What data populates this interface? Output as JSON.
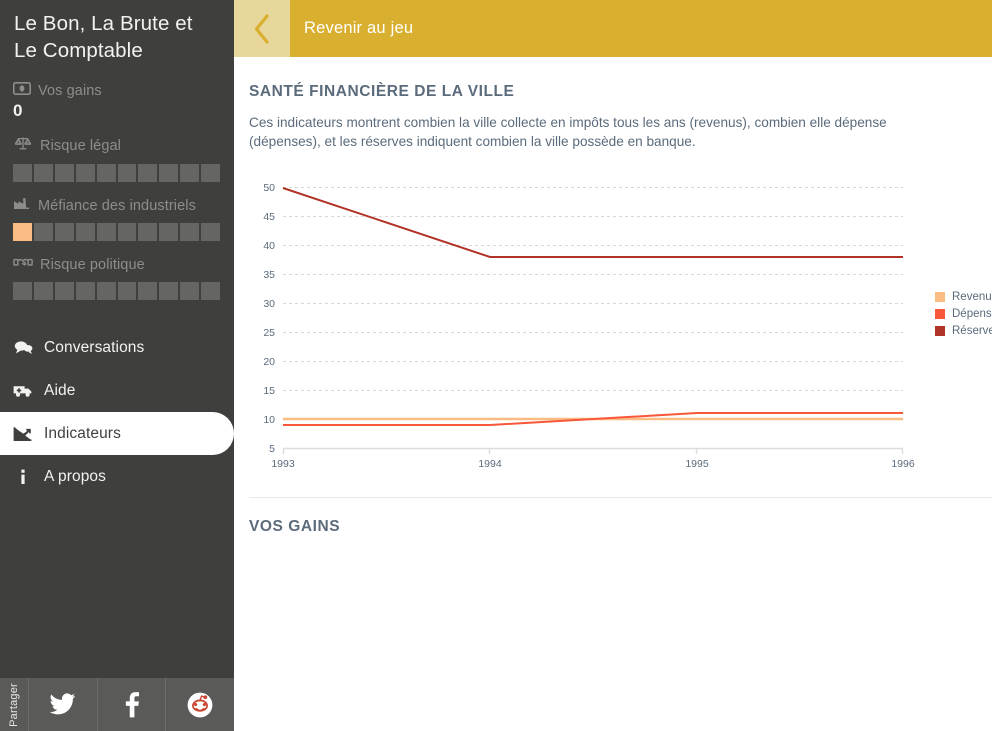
{
  "sidebar": {
    "title": "Le Bon, La Brute et Le Comptable",
    "gains": {
      "icon": "banknote-icon",
      "label": "Vos gains",
      "value": "0"
    },
    "meters": [
      {
        "icon": "scales-icon",
        "label": "Risque légal",
        "segments": 10,
        "filled": 0
      },
      {
        "icon": "factory-icon",
        "label": "Méfiance des industriels",
        "segments": 10,
        "filled": 1
      },
      {
        "icon": "handshake-icon",
        "label": "Risque politique",
        "segments": 10,
        "filled": 0
      }
    ],
    "nav": [
      {
        "icon": "chat-icon",
        "label": "Conversations",
        "active": false
      },
      {
        "icon": "ambulance-icon",
        "label": "Aide",
        "active": false
      },
      {
        "icon": "chart-line-icon",
        "label": "Indicateurs",
        "active": true
      },
      {
        "icon": "info-icon",
        "label": "A propos",
        "active": false
      }
    ],
    "share": {
      "label": "Partager",
      "buttons": [
        {
          "icon": "twitter-icon",
          "name": "Twitter"
        },
        {
          "icon": "facebook-icon",
          "name": "Facebook"
        },
        {
          "icon": "reddit-icon",
          "name": "Reddit"
        }
      ]
    }
  },
  "topbar": {
    "back_icon": "chevron-left-icon",
    "title": "Revenir au jeu"
  },
  "main": {
    "section_title": "SANTÉ FINANCIÈRE DE LA VILLE",
    "section_desc": "Ces indicateurs montrent combien la ville collecte en impôts tous les ans (revenus), combien elle dépense (dépenses), et les réserves indiquent combien la ville possède en banque.",
    "section2_title": "VOS GAINS"
  },
  "colors": {
    "gold": "#d9af2f",
    "gold_light": "#e8d79a",
    "sidebar_bg": "#3f3f3e",
    "revenus": "#fbbc83",
    "depenses": "#f9573a",
    "reserves": "#b03526",
    "text_slate": "#5b6b7c"
  },
  "chart_data": {
    "type": "line",
    "title": "",
    "xlabel": "",
    "ylabel": "",
    "x": [
      "1993",
      "1994",
      "1995",
      "1996"
    ],
    "xlim": [
      1993,
      1996
    ],
    "ylim": [
      5,
      50
    ],
    "yticks": [
      5,
      10,
      15,
      20,
      25,
      30,
      35,
      40,
      45,
      50
    ],
    "grid": true,
    "legend_position": "right",
    "series": [
      {
        "name": "Revenus",
        "color": "#fbbc83",
        "values": [
          10,
          10,
          10,
          10
        ]
      },
      {
        "name": "Dépenses",
        "color": "#f9573a",
        "values": [
          9,
          9,
          11,
          11
        ]
      },
      {
        "name": "Réserves",
        "color": "#b03526",
        "values": [
          50,
          38,
          38,
          38
        ]
      }
    ]
  }
}
